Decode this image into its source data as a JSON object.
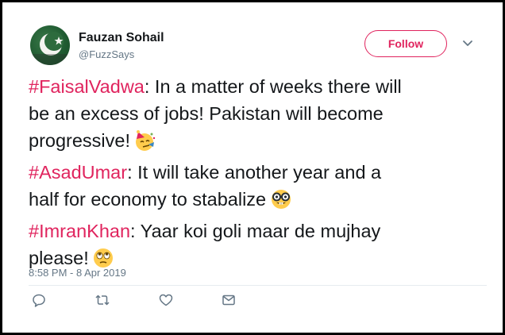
{
  "user": {
    "name": "Fauzan Sohail",
    "handle": "@FuzzSays"
  },
  "follow_button": {
    "label": "Follow"
  },
  "tweet": {
    "lines": [
      {
        "tag": "#FaisalVadwa",
        "text": ": In a matter of weeks there will"
      },
      {
        "text": "be an excess of jobs! Pakistan will become"
      },
      {
        "text": "progressive!",
        "emoji": "party-face-emoji"
      },
      {
        "tag": "#AsadUmar",
        "text": ": It will take another year and a"
      },
      {
        "text": "half for economy to stabalize",
        "emoji": "nerd-face-emoji"
      },
      {
        "tag": "#ImranKhan",
        "text": ": Yaar koi goli maar de mujhay"
      },
      {
        "text": "please!",
        "emoji": "rolling-eyes-emoji"
      }
    ],
    "timestamp": "8:58 PM - 8 Apr 2019"
  },
  "actions": [
    "reply-icon",
    "retweet-icon",
    "like-icon",
    "message-icon"
  ],
  "colors": {
    "accent": "#e0245e",
    "text": "#14171a",
    "secondary": "#657786",
    "icon": "#657786"
  }
}
